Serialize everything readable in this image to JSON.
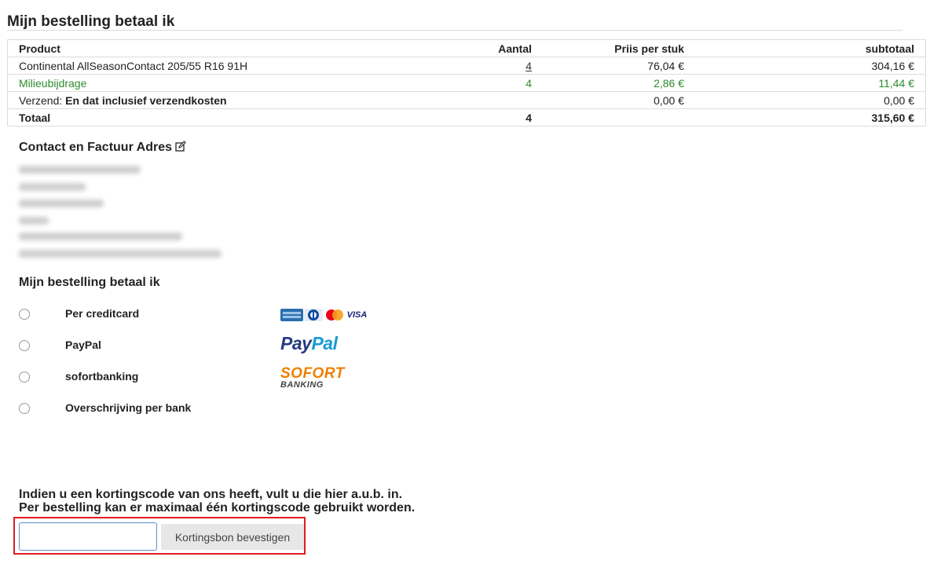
{
  "page": {
    "title": "Mijn bestelling betaal ik"
  },
  "order_table": {
    "headers": {
      "product": "Product",
      "quantity": "Aantal",
      "unit_price": "Priis per stuk",
      "subtotal": "subtotaal"
    },
    "rows": [
      {
        "product": "Continental AllSeasonContact 205/55 R16 91H",
        "quantity": "4",
        "unit_price": "76,04 €",
        "subtotal": "304,16 €"
      },
      {
        "product": "Milieubijdrage",
        "quantity": "4",
        "unit_price": "2,86 €",
        "subtotal": "11,44 €"
      }
    ],
    "shipping": {
      "label": "Verzend:",
      "description": "En dat inclusief verzendkosten",
      "unit_price": "0,00 €",
      "subtotal": "0,00 €"
    },
    "total": {
      "label": "Totaal",
      "quantity": "4",
      "amount": "315,60 €"
    }
  },
  "contact": {
    "heading": "Contact en Factuur Adres",
    "edit_icon": "edit-icon"
  },
  "payment": {
    "heading": "Mijn bestelling betaal ik",
    "methods": [
      {
        "label": "Per creditcard",
        "logo": "credit-card-logos"
      },
      {
        "label": "PayPal",
        "logo": "paypal-logo"
      },
      {
        "label": "sofortbanking",
        "logo": "sofort-banking-logo"
      },
      {
        "label": "Overschrijving per bank",
        "logo": ""
      }
    ],
    "logos": {
      "paypal_part1": "Pay",
      "paypal_part2": "Pal",
      "sofort_top": "SOFORT",
      "sofort_bottom": "BANKING",
      "visa": "VISA"
    }
  },
  "coupon": {
    "line1": "Indien u een kortingscode van ons heeft, vult u die hier a.u.b. in.",
    "line2": "Per bestelling kan er maximaal één kortingscode gebruikt worden.",
    "input_value": "",
    "input_placeholder": "",
    "button_label": "Kortingsbon bevestigen"
  },
  "colors": {
    "accent_green": "#2e8b2e",
    "highlight_red": "#e01b24",
    "paypal_dark": "#253b80",
    "paypal_light": "#179bd7",
    "sofort_orange": "#ee7f00"
  }
}
